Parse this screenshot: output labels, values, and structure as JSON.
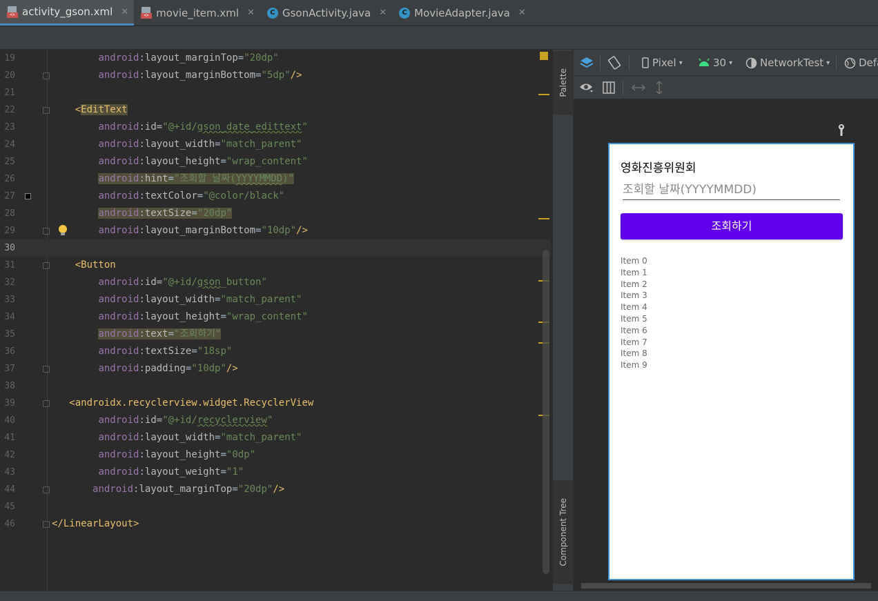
{
  "tabs": [
    {
      "label": "activity_gson.xml",
      "icon": "xml-file-icon",
      "active": true
    },
    {
      "label": "movie_item.xml",
      "icon": "xml-file-icon",
      "active": false
    },
    {
      "label": "GsonActivity.java",
      "icon": "java-class-icon",
      "active": false
    },
    {
      "label": "MovieAdapter.java",
      "icon": "java-class-icon",
      "active": false
    }
  ],
  "tab_close": "✕",
  "editor": {
    "current_line": 30,
    "lines": [
      {
        "n": "19",
        "indent": "        ",
        "parts": [
          [
            "attr-ns",
            "android"
          ],
          [
            "punct",
            ":"
          ],
          [
            "attr",
            "layout_marginTop"
          ],
          [
            "punct",
            "="
          ],
          [
            "val",
            "\"20dp\""
          ]
        ]
      },
      {
        "n": "20",
        "indent": "        ",
        "parts": [
          [
            "attr-ns",
            "android"
          ],
          [
            "punct",
            ":"
          ],
          [
            "attr",
            "layout_marginBottom"
          ],
          [
            "punct",
            "="
          ],
          [
            "val",
            "\"5dp\""
          ],
          [
            "tag",
            "/>"
          ]
        ]
      },
      {
        "n": "21",
        "indent": "",
        "parts": []
      },
      {
        "n": "22",
        "indent": "    ",
        "parts": [
          [
            "tag",
            "<"
          ],
          [
            "tag hl",
            "EditText"
          ]
        ]
      },
      {
        "n": "23",
        "indent": "        ",
        "parts": [
          [
            "attr-ns",
            "android"
          ],
          [
            "punct",
            ":"
          ],
          [
            "attr",
            "id"
          ],
          [
            "punct",
            "="
          ],
          [
            "val",
            "\"@+id/"
          ],
          [
            "val squig",
            "gson_date_edittext"
          ],
          [
            "val",
            "\""
          ]
        ]
      },
      {
        "n": "24",
        "indent": "        ",
        "parts": [
          [
            "attr-ns",
            "android"
          ],
          [
            "punct",
            ":"
          ],
          [
            "attr",
            "layout_width"
          ],
          [
            "punct",
            "="
          ],
          [
            "val",
            "\"match_parent\""
          ]
        ]
      },
      {
        "n": "25",
        "indent": "        ",
        "parts": [
          [
            "attr-ns",
            "android"
          ],
          [
            "punct",
            ":"
          ],
          [
            "attr",
            "layout_height"
          ],
          [
            "punct",
            "="
          ],
          [
            "val",
            "\"wrap_content\""
          ]
        ]
      },
      {
        "n": "26",
        "indent": "        ",
        "parts": [
          [
            "attr-ns hl",
            "android"
          ],
          [
            "punct hl",
            ":"
          ],
          [
            "attr hl",
            "hint"
          ],
          [
            "punct hl",
            "="
          ],
          [
            "val hl",
            "\"조회할 날짜("
          ],
          [
            "val hl squig",
            "YYYYMMDD"
          ],
          [
            "val hl",
            ")\""
          ]
        ]
      },
      {
        "n": "27",
        "indent": "        ",
        "parts": [
          [
            "attr-ns",
            "android"
          ],
          [
            "punct",
            ":"
          ],
          [
            "attr",
            "textColor"
          ],
          [
            "punct",
            "="
          ],
          [
            "val",
            "\"@color/black\""
          ]
        ]
      },
      {
        "n": "28",
        "indent": "        ",
        "parts": [
          [
            "attr-ns hl",
            "android"
          ],
          [
            "punct hl",
            ":"
          ],
          [
            "attr hl",
            "textSize"
          ],
          [
            "punct hl",
            "="
          ],
          [
            "val hl",
            "\"20dp\""
          ]
        ]
      },
      {
        "n": "29",
        "indent": "        ",
        "parts": [
          [
            "attr-ns",
            "android"
          ],
          [
            "punct",
            ":"
          ],
          [
            "attr",
            "layout_marginBottom"
          ],
          [
            "punct",
            "="
          ],
          [
            "val",
            "\"10dp\""
          ],
          [
            "tag",
            "/>"
          ]
        ]
      },
      {
        "n": "30",
        "indent": "",
        "parts": []
      },
      {
        "n": "31",
        "indent": "    ",
        "parts": [
          [
            "tag",
            "<Button"
          ]
        ]
      },
      {
        "n": "32",
        "indent": "        ",
        "parts": [
          [
            "attr-ns",
            "android"
          ],
          [
            "punct",
            ":"
          ],
          [
            "attr",
            "id"
          ],
          [
            "punct",
            "="
          ],
          [
            "val",
            "\"@+id/"
          ],
          [
            "val squig",
            "gson"
          ],
          [
            "val",
            "_button\""
          ]
        ]
      },
      {
        "n": "33",
        "indent": "        ",
        "parts": [
          [
            "attr-ns",
            "android"
          ],
          [
            "punct",
            ":"
          ],
          [
            "attr",
            "layout_width"
          ],
          [
            "punct",
            "="
          ],
          [
            "val",
            "\"match_parent\""
          ]
        ]
      },
      {
        "n": "34",
        "indent": "        ",
        "parts": [
          [
            "attr-ns",
            "android"
          ],
          [
            "punct",
            ":"
          ],
          [
            "attr",
            "layout_height"
          ],
          [
            "punct",
            "="
          ],
          [
            "val",
            "\"wrap_content\""
          ]
        ]
      },
      {
        "n": "35",
        "indent": "        ",
        "parts": [
          [
            "attr-ns hl",
            "android"
          ],
          [
            "punct hl",
            ":"
          ],
          [
            "attr hl",
            "text"
          ],
          [
            "punct hl",
            "="
          ],
          [
            "val hl",
            "\"조회하기\""
          ]
        ]
      },
      {
        "n": "36",
        "indent": "        ",
        "parts": [
          [
            "attr-ns",
            "android"
          ],
          [
            "punct",
            ":"
          ],
          [
            "attr",
            "textSize"
          ],
          [
            "punct",
            "="
          ],
          [
            "val",
            "\"18sp\""
          ]
        ]
      },
      {
        "n": "37",
        "indent": "        ",
        "parts": [
          [
            "attr-ns",
            "android"
          ],
          [
            "punct",
            ":"
          ],
          [
            "attr",
            "padding"
          ],
          [
            "punct",
            "="
          ],
          [
            "val",
            "\"10dp\""
          ],
          [
            "tag",
            "/>"
          ]
        ]
      },
      {
        "n": "38",
        "indent": "",
        "parts": []
      },
      {
        "n": "39",
        "indent": "   ",
        "parts": [
          [
            "tag",
            "<androidx.recyclerview.widget.RecyclerView"
          ]
        ]
      },
      {
        "n": "40",
        "indent": "        ",
        "parts": [
          [
            "attr-ns",
            "android"
          ],
          [
            "punct",
            ":"
          ],
          [
            "attr",
            "id"
          ],
          [
            "punct",
            "="
          ],
          [
            "val",
            "\"@+id/"
          ],
          [
            "val squig",
            "recyclerview"
          ],
          [
            "val",
            "\""
          ]
        ]
      },
      {
        "n": "41",
        "indent": "        ",
        "parts": [
          [
            "attr-ns",
            "android"
          ],
          [
            "punct",
            ":"
          ],
          [
            "attr",
            "layout_width"
          ],
          [
            "punct",
            "="
          ],
          [
            "val",
            "\"match_parent\""
          ]
        ]
      },
      {
        "n": "42",
        "indent": "        ",
        "parts": [
          [
            "attr-ns",
            "android"
          ],
          [
            "punct",
            ":"
          ],
          [
            "attr",
            "layout_height"
          ],
          [
            "punct",
            "="
          ],
          [
            "val",
            "\"0dp\""
          ]
        ]
      },
      {
        "n": "43",
        "indent": "        ",
        "parts": [
          [
            "attr-ns",
            "android"
          ],
          [
            "punct",
            ":"
          ],
          [
            "attr",
            "layout_weight"
          ],
          [
            "punct",
            "="
          ],
          [
            "val",
            "\"1\""
          ]
        ]
      },
      {
        "n": "44",
        "indent": "       ",
        "parts": [
          [
            "attr-ns",
            "android"
          ],
          [
            "punct",
            ":"
          ],
          [
            "attr",
            "layout_marginTop"
          ],
          [
            "punct",
            "="
          ],
          [
            "val",
            "\"20dp\""
          ],
          [
            "tag",
            "/>"
          ]
        ]
      },
      {
        "n": "45",
        "indent": "",
        "parts": []
      },
      {
        "n": "46",
        "indent": "",
        "parts": [
          [
            "tag",
            "</LinearLayout>"
          ]
        ]
      }
    ]
  },
  "side_tabs": {
    "palette": "Palette",
    "component_tree": "Component Tree"
  },
  "design_toolbar": {
    "device": "Pixel",
    "api": "30",
    "theme": "NetworkTest",
    "locale": "Defa"
  },
  "preview": {
    "title": "영화진흥위원회",
    "edit_hint": "조회할 날짜(YYYYMMDD)",
    "button_label": "조회하기",
    "items": [
      "Item 0",
      "Item 1",
      "Item 2",
      "Item 3",
      "Item 4",
      "Item 5",
      "Item 6",
      "Item 7",
      "Item 8",
      "Item 9"
    ],
    "button_color": "#6200ee"
  },
  "colors": {
    "accent": "#4a88c7",
    "warning": "#c8a023"
  }
}
